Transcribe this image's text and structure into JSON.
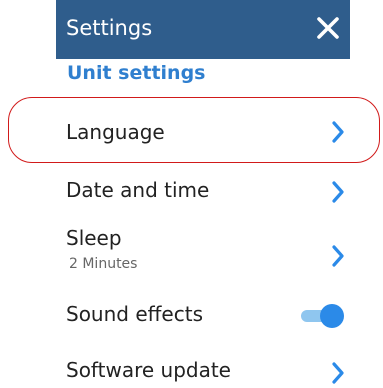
{
  "header": {
    "title": "Settings",
    "close_icon": "close-icon"
  },
  "section": {
    "title": "Unit settings"
  },
  "items": [
    {
      "label": "Language",
      "icon": "chevron-right-icon"
    },
    {
      "label": "Date and time",
      "icon": "chevron-right-icon"
    },
    {
      "label": "Sleep",
      "sublabel": "2 Minutes",
      "icon": "chevron-right-icon"
    },
    {
      "label": "Sound effects",
      "toggle_on": true
    },
    {
      "label": "Software update",
      "icon": "chevron-right-icon"
    }
  ],
  "colors": {
    "header_bg": "#2f5d8c",
    "accent": "#2b8ae8",
    "section_title": "#2f7fcf",
    "highlight": "#d11a1a"
  }
}
